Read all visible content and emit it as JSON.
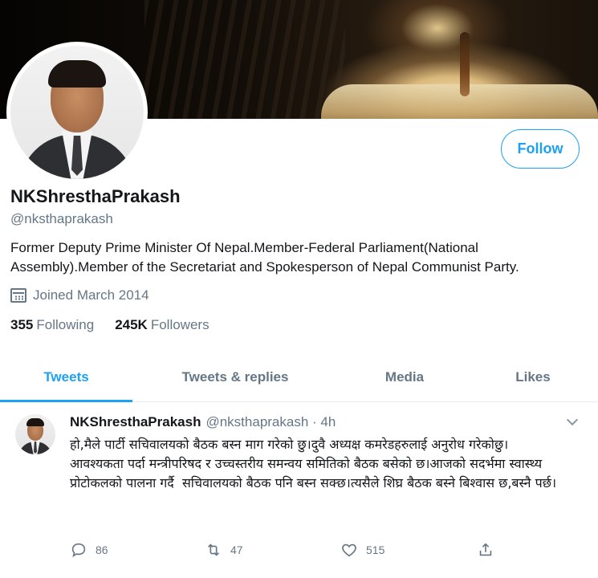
{
  "profile": {
    "display_name": "NKShresthaPrakash",
    "handle": "@nksthaprakash",
    "bio": "Former Deputy Prime Minister Of Nepal.Member-Federal Parliament(National Assembly).Member of the Secretariat and Spokesperson of Nepal Communist Party.",
    "joined": "Joined March 2014",
    "joined_icon": "calendar-icon",
    "follow_label": "Follow",
    "following_count": "355",
    "following_label": "Following",
    "followers_count": "245K",
    "followers_label": "Followers"
  },
  "tabs": [
    {
      "label": "Tweets",
      "active": true
    },
    {
      "label": "Tweets & replies",
      "active": false
    },
    {
      "label": "Media",
      "active": false
    },
    {
      "label": "Likes",
      "active": false
    }
  ],
  "tweet": {
    "name": "NKShresthaPrakash",
    "meta": "@nksthaprakash · 4h",
    "text": "हो,मैले पार्टी सचिवालयको बैठक बस्न माग गरेको छु।दुवै अध्यक्ष कमरेडहरुलाई अनुरोध गरेकोछु।\nआवश्यकता पर्दा मन्त्रीपरिषद र उच्चस्तरीय समन्वय समितिको बैठक बसेको छ।आजको सदर्भमा स्वास्थ्य प्रोटोकलको पालना गर्दै  सचिवालयको बैठक पनि बस्न सक्छ।त्यसैले शिघ्र बैठक बस्ने बिश्वास छ,बस्नै पर्छ।",
    "replies": "86",
    "retweets": "47",
    "likes": "515"
  },
  "colors": {
    "accent": "#1da1f2",
    "secondary_text": "#657786",
    "border": "#e6ecf0"
  }
}
